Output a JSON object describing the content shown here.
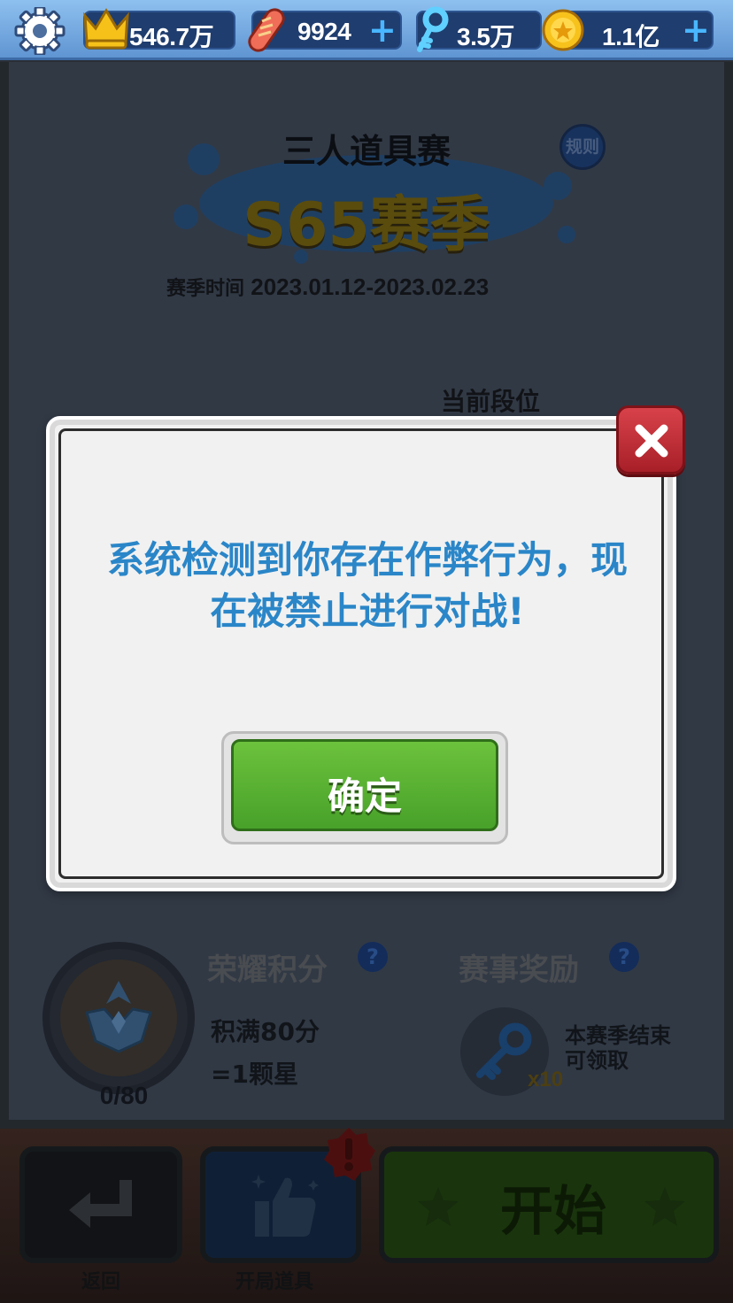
{
  "topbar": {
    "crowns": "546.7万",
    "boards": "9924",
    "keys": "3.5万",
    "coins": "1.1亿",
    "plus": "+"
  },
  "mode": {
    "title": "三人道具赛",
    "season_label": "S65赛季",
    "rules_label": "规则",
    "season_time_label": "赛季时间",
    "season_time_value": "2023.01.12-2023.02.23",
    "rank_title": "当前段位"
  },
  "honor": {
    "title": "荣耀积分",
    "rule_line1": "积满80分",
    "rule_line2": "=1颗星",
    "score": "0/80"
  },
  "reward": {
    "title": "赛事奖励",
    "desc_line1": "本赛季结束",
    "desc_line2": "可领取",
    "key_count": "x10"
  },
  "bottom": {
    "back_label": "返回",
    "items_label": "开局道具",
    "start_label": "开始"
  },
  "dialog": {
    "message": "系统检测到你存在作弊行为，现在被禁止进行对战!",
    "ok_label": "确定"
  },
  "icons": {
    "settings": "gear-icon",
    "crown": "crown-icon",
    "board": "skateboard-icon",
    "key": "key-icon",
    "coin": "coin-icon",
    "close": "close-icon",
    "back": "return-arrow-icon",
    "thumbs": "thumbs-up-icon",
    "star": "star-icon",
    "alert": "alert-badge-icon"
  },
  "colors": {
    "dialog_text": "#2a86c8",
    "ok_button": "#52ab2f",
    "close_button": "#c3333b",
    "topbar": "#7fb0e6"
  }
}
